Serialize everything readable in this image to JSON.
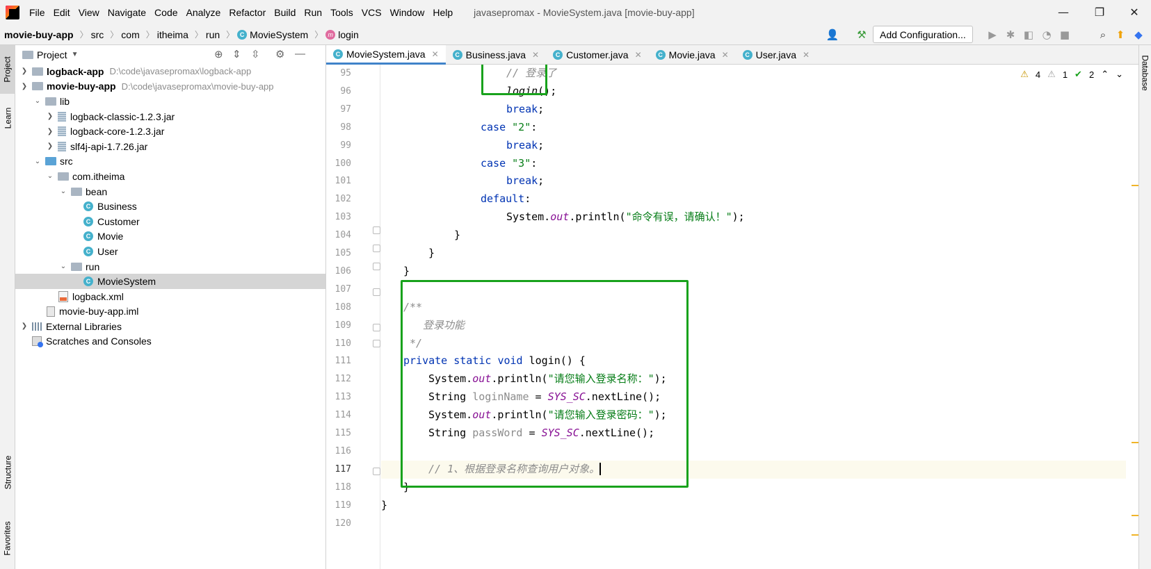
{
  "menu": [
    "File",
    "Edit",
    "View",
    "Navigate",
    "Code",
    "Analyze",
    "Refactor",
    "Build",
    "Run",
    "Tools",
    "VCS",
    "Window",
    "Help"
  ],
  "window_title": "javasepromax - MovieSystem.java [movie-buy-app]",
  "breadcrumb": [
    "movie-buy-app",
    "src",
    "com",
    "itheima",
    "run",
    "MovieSystem",
    "login"
  ],
  "toolbar": {
    "add_configuration": "Add Configuration..."
  },
  "left_tabs": [
    "Project",
    "Learn",
    "Structure",
    "Favorites"
  ],
  "right_tabs": [
    "Database"
  ],
  "project_panel": {
    "title": "Project",
    "tree": [
      {
        "name": "logback-app",
        "path": "D:\\code\\javasepromax\\logback-app",
        "bold": true
      },
      {
        "name": "movie-buy-app",
        "path": "D:\\code\\javasepromax\\movie-buy-app",
        "bold": true
      },
      {
        "name": "lib"
      },
      {
        "name": "logback-classic-1.2.3.jar"
      },
      {
        "name": "logback-core-1.2.3.jar"
      },
      {
        "name": "slf4j-api-1.7.26.jar"
      },
      {
        "name": "src"
      },
      {
        "name": "com.itheima"
      },
      {
        "name": "bean"
      },
      {
        "name": "Business"
      },
      {
        "name": "Customer"
      },
      {
        "name": "Movie"
      },
      {
        "name": "User"
      },
      {
        "name": "run"
      },
      {
        "name": "MovieSystem"
      },
      {
        "name": "logback.xml"
      },
      {
        "name": "movie-buy-app.iml"
      },
      {
        "name": "External Libraries"
      },
      {
        "name": "Scratches and Consoles"
      }
    ]
  },
  "tabs": [
    "MovieSystem.java",
    "Business.java",
    "Customer.java",
    "Movie.java",
    "User.java"
  ],
  "inspections": {
    "warnings": "4",
    "weak_warnings": "1",
    "typos": "2"
  },
  "line_numbers": [
    "95",
    "96",
    "97",
    "98",
    "99",
    "100",
    "101",
    "102",
    "103",
    "104",
    "105",
    "106",
    "107",
    "108",
    "109",
    "110",
    "111",
    "112",
    "113",
    "114",
    "115",
    "116",
    "117",
    "118",
    "119",
    "120"
  ],
  "code": {
    "l95": "// 登录了",
    "l96": "login",
    "l96b": "();",
    "l97": "break",
    "l98_kw": "case",
    "l98_str": "\"2\"",
    "l99": "break",
    "l100_kw": "case",
    "l100_str": "\"3\"",
    "l101": "break",
    "l102": "default",
    "l103_a": "System.",
    "l103_b": "out",
    "l103_c": ".println(",
    "l103_str": "\"命令有误，请确认！\"",
    "l103_d": ");",
    "l108": "/**",
    "l109": "登录功能",
    "l110": " */",
    "l111_a": "private static void",
    "l111_b": " login() {",
    "l112_a": "System.",
    "l112_b": "out",
    "l112_c": ".println(",
    "l112_str": "\"请您输入登录名称：\"",
    "l112_d": ");",
    "l113_a": "String ",
    "l113_b": "loginName",
    "l113_c": " = ",
    "l113_d": "SYS_SC",
    "l113_e": ".nextLine();",
    "l114_a": "System.",
    "l114_b": "out",
    "l114_c": ".println(",
    "l114_str": "\"请您输入登录密码：\"",
    "l114_d": ");",
    "l115_a": "String ",
    "l115_b": "passWord",
    "l115_c": " = ",
    "l115_d": "SYS_SC",
    "l115_e": ".nextLine();",
    "l117": "// 1、根据登录名称查询用户对象。"
  },
  "colors": {
    "highlight_box": "#18a21c",
    "keyword": "#0033b3",
    "string": "#067d17",
    "static_field": "#871094",
    "comment": "#8c8c8c",
    "tab_underline": "#4083c9"
  }
}
